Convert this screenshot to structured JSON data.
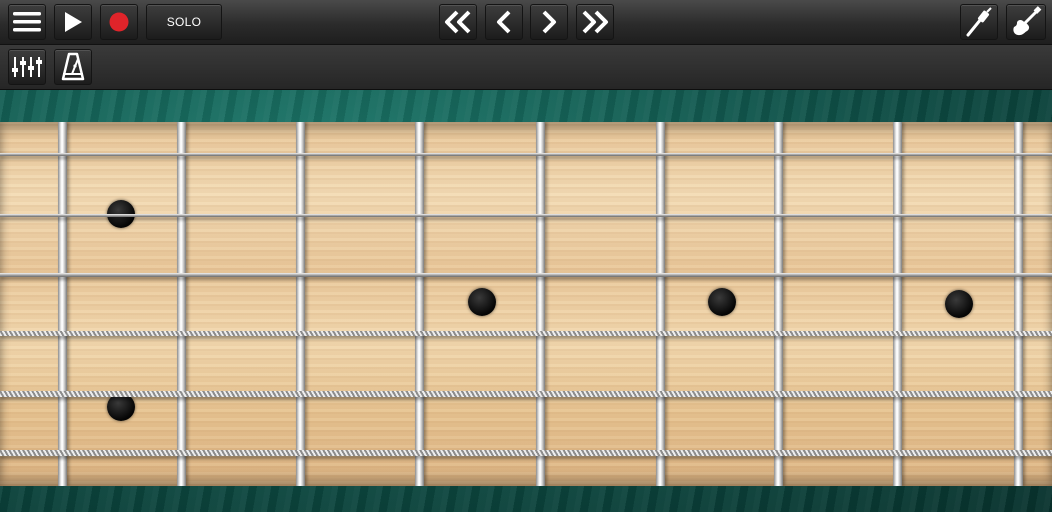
{
  "toolbar": {
    "menu_icon": "hamburger-menu-icon",
    "play_icon": "play-icon",
    "record_icon": "record-icon",
    "record_color": "#e0242a",
    "solo_label": "SOLO",
    "rewind_fast_icon": "double-chevron-left-icon",
    "rewind_icon": "chevron-left-icon",
    "forward_icon": "chevron-right-icon",
    "forward_fast_icon": "double-chevron-right-icon",
    "cable_icon": "guitar-cable-icon",
    "instrument_icon": "electric-guitar-icon"
  },
  "subbar": {
    "mixer_icon": "mixer-sliders-icon",
    "metronome_icon": "metronome-icon"
  },
  "fretboard": {
    "wood_color": "#f0d6ac",
    "felt_color": "#0f5a50",
    "string_count": 6,
    "fret_count": 9,
    "inlay_count": 5
  }
}
